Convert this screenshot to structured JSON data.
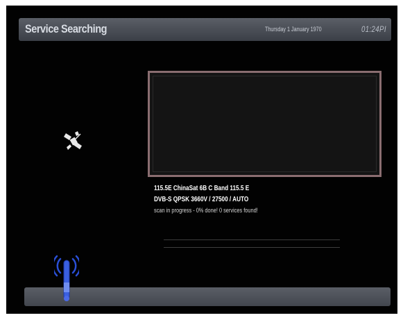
{
  "header": {
    "title": "Service Searching",
    "date": "Thursday 1 January 1970",
    "clock": "01:24PI"
  },
  "scan": {
    "transponder": "115.5E ChinaSat 6B C Band 115.5 E",
    "parameters": "DVB-S QPSK 3660V / 27500 / AUTO",
    "status": "scan in progress - 0% done! 0 services found!",
    "progress": 0
  },
  "icons": {
    "satellite": "satellite-icon",
    "signal": "signal-antenna-icon"
  },
  "colors": {
    "preview_border": "#8a6d70",
    "signal_blue": "#2a4fd6"
  }
}
